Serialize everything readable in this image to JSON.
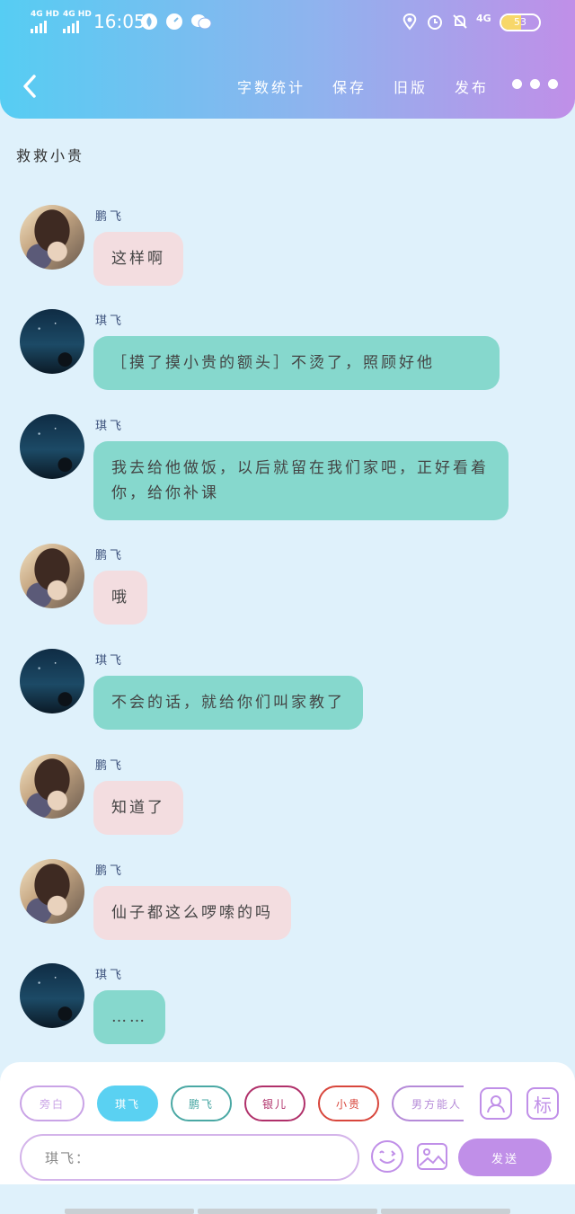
{
  "status_bar": {
    "signal_1": "4G HD",
    "signal_2": "4G HD",
    "time": "16:05",
    "network": "4G",
    "battery": "53",
    "battery_level": 0.53
  },
  "header": {
    "nav": [
      "字数统计",
      "保存",
      "旧版",
      "发布"
    ]
  },
  "conversation": {
    "title": "救救小贵"
  },
  "messages": [
    {
      "sender": "鹏飞",
      "text": "这样啊",
      "avatar": "pf",
      "color": "pink"
    },
    {
      "sender": "琪飞",
      "text": "［摸了摸小贵的额头］不烫了，照顾好他",
      "avatar": "qf",
      "color": "teal"
    },
    {
      "sender": "琪飞",
      "text": "我去给他做饭，以后就留在我们家吧，正好看着你，给你补课",
      "avatar": "qf",
      "color": "teal"
    },
    {
      "sender": "鹏飞",
      "text": "哦",
      "avatar": "pf",
      "color": "pink"
    },
    {
      "sender": "琪飞",
      "text": "不会的话，就给你们叫家教了",
      "avatar": "qf",
      "color": "teal"
    },
    {
      "sender": "鹏飞",
      "text": "知道了",
      "avatar": "pf",
      "color": "pink"
    },
    {
      "sender": "鹏飞",
      "text": "仙子都这么啰嗦的吗",
      "avatar": "pf",
      "color": "pink"
    },
    {
      "sender": "琪飞",
      "text": "……",
      "avatar": "qf",
      "color": "teal"
    }
  ],
  "composer": {
    "chips": [
      {
        "label": "旁白",
        "color": "#c9a3e6"
      },
      {
        "label": "琪飞",
        "color": "#5ad1f2"
      },
      {
        "label": "鹏飞",
        "color": "#4aa8a4"
      },
      {
        "label": "银儿",
        "color": "#b0306a"
      },
      {
        "label": "小贵",
        "color": "#d8463c"
      },
      {
        "label": "男方能人",
        "color": "#b58ad8"
      }
    ],
    "tag_button": "标",
    "input_value": "琪飞：",
    "send_label": "发送"
  }
}
